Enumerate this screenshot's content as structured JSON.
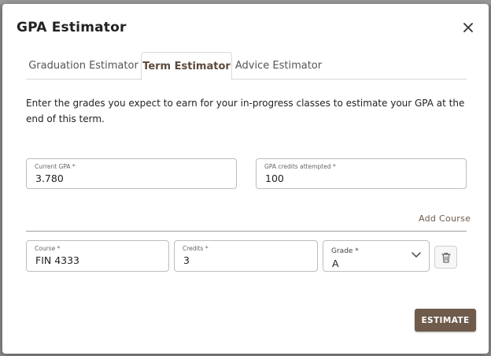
{
  "dialog": {
    "title": "GPA Estimator",
    "close_icon": "close-icon"
  },
  "tabs": [
    {
      "label": "Graduation Estimator",
      "active": false
    },
    {
      "label": "Term Estimator",
      "active": true
    },
    {
      "label": "Advice Estimator",
      "active": false
    }
  ],
  "intro_text": "Enter the grades you expect to earn for your in-progress classes to estimate your GPA at the end of this term.",
  "current_gpa": {
    "label": "Current GPA *",
    "value": "3.780"
  },
  "credits_attempted": {
    "label": "GPA credits attempted *",
    "value": "100"
  },
  "add_course_label": "Add Course",
  "course_row": {
    "course": {
      "label": "Course *",
      "value": "FIN 4333"
    },
    "credits": {
      "label": "Credits *",
      "value": "3"
    },
    "grade": {
      "label": "Grade *",
      "value": "A"
    },
    "delete_icon": "trash-icon"
  },
  "estimate_label": "ESTIMATE",
  "colors": {
    "accent": "#6f5b4b",
    "active_tab_text": "#5b4a3c",
    "backdrop": "#8a8a8a"
  }
}
